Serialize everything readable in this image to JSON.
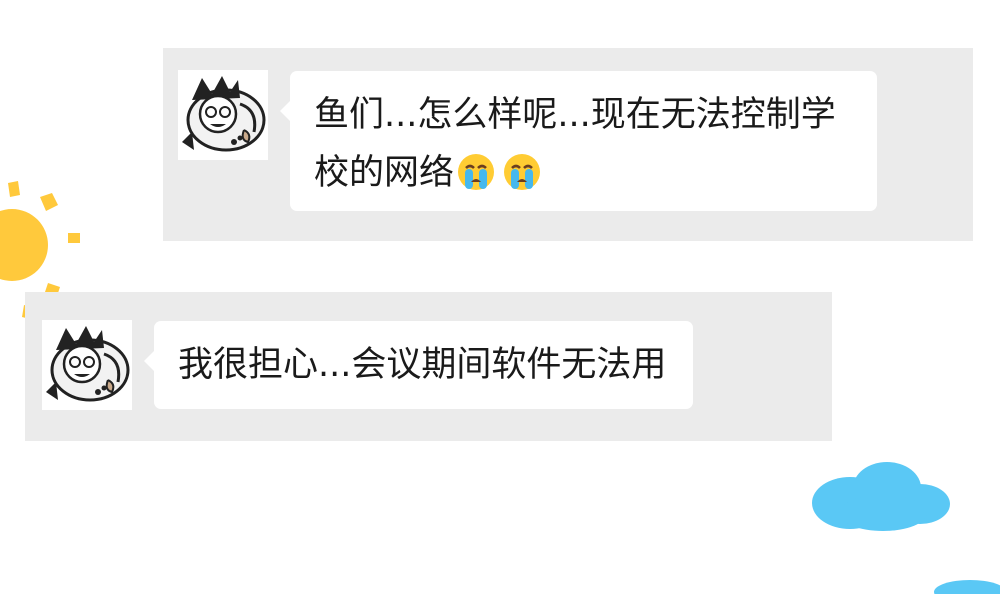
{
  "messages": [
    {
      "text": "鱼们...怎么样呢...现在无法控制学校的网络",
      "emojis": [
        "crying-face-icon",
        "crying-face-icon"
      ]
    },
    {
      "text": "我很担心...会议期间软件无法用",
      "emojis": []
    }
  ],
  "colors": {
    "row_background": "#ebebeb",
    "bubble_background": "#ffffff",
    "sun": "#ffc93c",
    "cloud": "#5ac8f5"
  }
}
